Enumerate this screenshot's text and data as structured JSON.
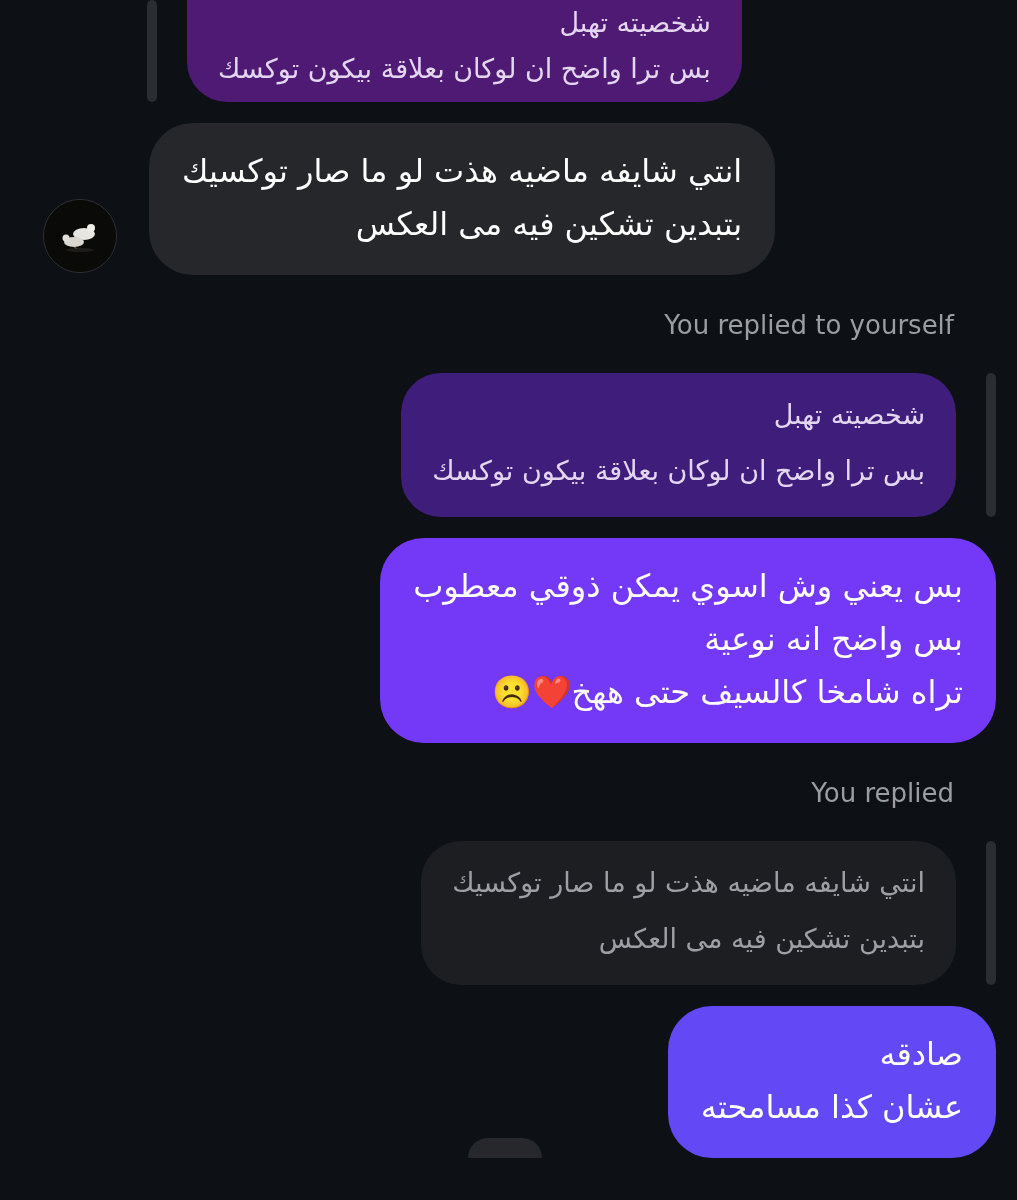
{
  "messages": [
    {
      "kind": "quote",
      "outgoing": false,
      "color": "#4f1a73",
      "muted": false,
      "lines": [
        "شخصيته تهبل",
        "بس ترا واضح ان لوكان بعلاقة بيكون توكسك"
      ]
    },
    {
      "kind": "message",
      "outgoing": false,
      "color": "#25272b",
      "avatar": true,
      "lines": [
        "انتي شايفه ماضيه هذت لو ما صار توكسيك",
        "بتبدين تشكين فيه مى العكس"
      ]
    },
    {
      "kind": "label",
      "outgoing": true,
      "text": "You replied to yourself"
    },
    {
      "kind": "quote",
      "outgoing": true,
      "color": "#3f1d7a",
      "muted": false,
      "lines": [
        "شخصيته تهبل",
        "بس ترا واضح ان لوكان بعلاقة بيكون توكسك"
      ]
    },
    {
      "kind": "message",
      "outgoing": true,
      "color": "#7438f7",
      "lines": [
        "بس يعني وش اسوي يمكن ذوقي معطوب",
        "بس واضح انه نوعية",
        "تراه شامخا كالسيف حتى  ههخ❤️☹️"
      ]
    },
    {
      "kind": "label",
      "outgoing": true,
      "text": "You replied"
    },
    {
      "kind": "quote",
      "outgoing": true,
      "color": "#1c1e22",
      "muted": true,
      "lines": [
        "انتي شايفه ماضيه هذت لو ما صار توكسيك",
        "بتبدين تشكين فيه مى العكس"
      ]
    },
    {
      "kind": "message",
      "outgoing": true,
      "color": "#6348f5",
      "lines": [
        "صادقه",
        "عشان كذا مسامحته"
      ]
    },
    {
      "kind": "peek"
    }
  ]
}
